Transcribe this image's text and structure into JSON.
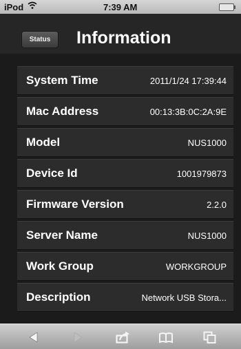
{
  "status_bar": {
    "carrier": "iPod",
    "time": "7:39 AM"
  },
  "header": {
    "back_label": "Status",
    "title": "Information"
  },
  "rows": [
    {
      "label": "System Time",
      "value": "2011/1/24 17:39:44"
    },
    {
      "label": "Mac Address",
      "value": "00:13:3B:0C:2A:9E"
    },
    {
      "label": "Model",
      "value": "NUS1000"
    },
    {
      "label": "Device Id",
      "value": "1001979873"
    },
    {
      "label": "Firmware Version",
      "value": "2.2.0"
    },
    {
      "label": "Server Name",
      "value": "NUS1000"
    },
    {
      "label": "Work Group",
      "value": "WORKGROUP"
    },
    {
      "label": "Description",
      "value": "Network USB Stora..."
    }
  ],
  "toolbar": {
    "icons": [
      "back-arrow-icon",
      "forward-arrow-icon",
      "share-icon",
      "bookmarks-icon",
      "tabs-icon"
    ]
  }
}
